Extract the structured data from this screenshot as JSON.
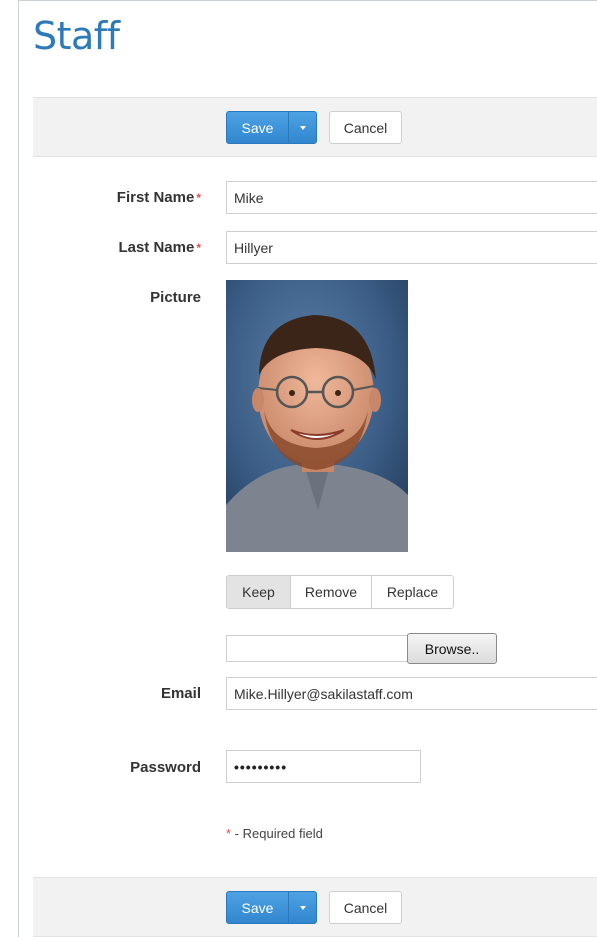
{
  "page": {
    "title": "Staff"
  },
  "toolbar_top": {
    "save_label": "Save",
    "cancel_label": "Cancel"
  },
  "toolbar_bottom": {
    "save_label": "Save",
    "cancel_label": "Cancel"
  },
  "form": {
    "first_name": {
      "label": "First Name",
      "required_mark": "*",
      "value": "Mike"
    },
    "last_name": {
      "label": "Last Name",
      "required_mark": "*",
      "value": "Hillyer"
    },
    "picture": {
      "label": "Picture",
      "actions": [
        "Keep",
        "Remove",
        "Replace"
      ],
      "selected_action": "Keep",
      "browse_label": "Browse.."
    },
    "email": {
      "label": "Email",
      "value": "Mike.Hillyer@sakilastaff.com"
    },
    "password": {
      "label": "Password",
      "value": "•••••••••"
    }
  },
  "required_note": {
    "star": "*",
    "text": " - Required field"
  },
  "colors": {
    "accent": "#3c92d8",
    "title": "#2e7ab8",
    "required": "#d9534f"
  }
}
